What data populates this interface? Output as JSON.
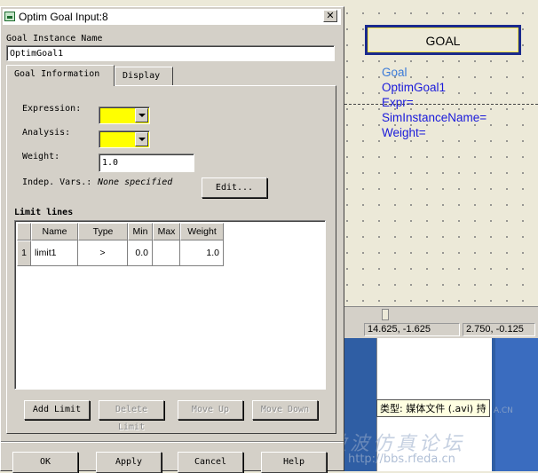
{
  "window": {
    "title": "Optim Goal Input:8",
    "close_symbol": "✕"
  },
  "instance": {
    "label": "Goal Instance Name",
    "value": "OptimGoal1"
  },
  "tabs": [
    {
      "label": "Goal Information",
      "active": true
    },
    {
      "label": "Display",
      "active": false
    }
  ],
  "form": {
    "expression_label": "Expression:",
    "analysis_label": "Analysis:",
    "weight_label": "Weight:",
    "weight_value": "1.0",
    "indep_label": "Indep. Vars.:",
    "indep_value": "None specified",
    "edit_button": "Edit...",
    "highlight_color": "#ffff00"
  },
  "limits": {
    "title": "Limit lines",
    "columns": [
      "Name",
      "Type",
      "Min",
      "Max",
      "Weight"
    ],
    "rows": [
      {
        "index": "1",
        "name": "limit1",
        "type": ">",
        "min": "0.0",
        "max": "",
        "weight": "1.0"
      }
    ]
  },
  "limit_buttons": {
    "add": "Add Limit",
    "delete": "Delete Limit",
    "move_up": "Move Up",
    "move_down": "Move Down"
  },
  "dialog_buttons": {
    "ok": "OK",
    "apply": "Apply",
    "cancel": "Cancel",
    "help": "Help"
  },
  "canvas": {
    "goal_box_label": "GOAL",
    "goal_lines": [
      "Goal",
      "OptimGoal1",
      "Expr=",
      "SimInstanceName=",
      "Weight="
    ],
    "status": [
      "14.625, -1.625",
      "2.750, -0.125"
    ]
  },
  "overlay": {
    "tooltip": "类型: 媒体文件 (.avi) 持",
    "watermark_main": "微波仿真论坛",
    "watermark_url": "http://bbs.rfeda.cn",
    "watermark_cn": "A.CN"
  }
}
